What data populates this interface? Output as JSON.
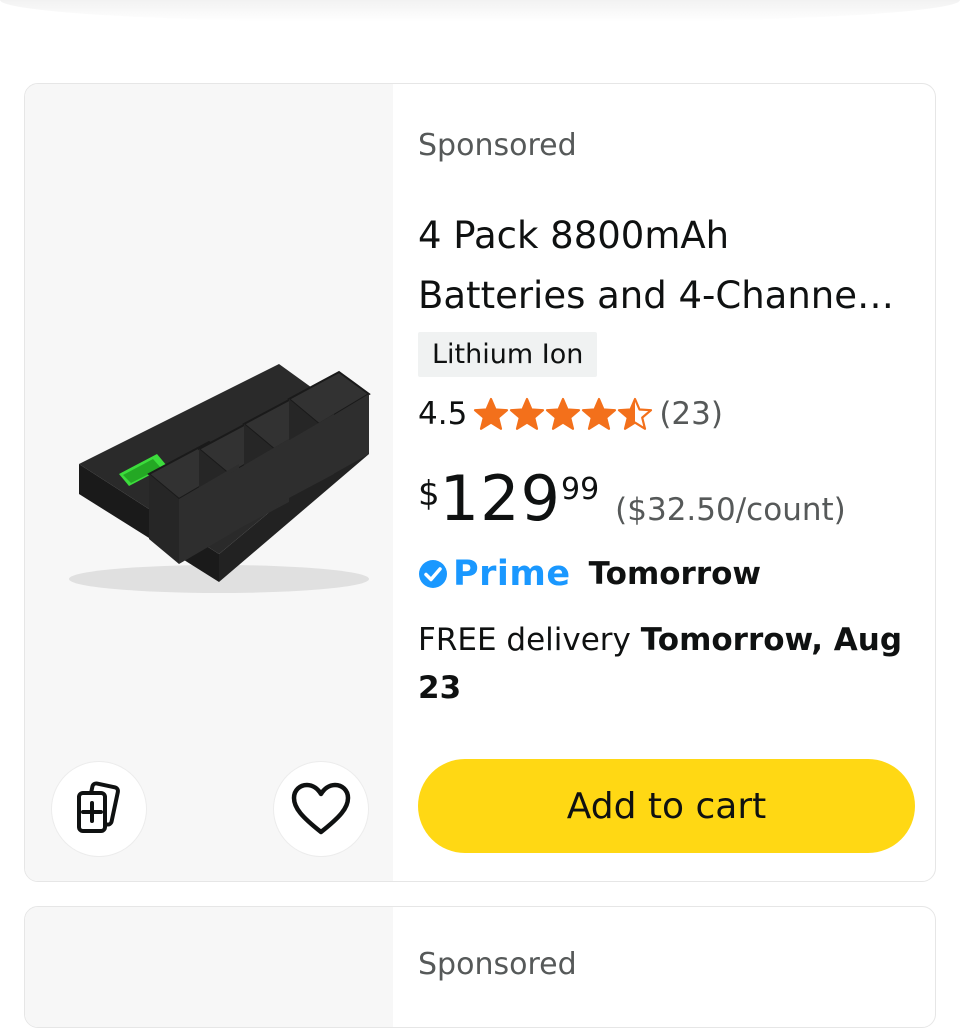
{
  "card": {
    "sponsored": "Sponsored",
    "title_line1": "4 Pack 8800mAh",
    "title_line2": "Batteries and 4-Channe…",
    "badge": "Lithium Ion",
    "rating": "4.5",
    "rating_value": 4.5,
    "stars_total": 5,
    "review_count": "(23)",
    "price_currency": "$",
    "price_whole": "129",
    "price_fraction": "99",
    "unit_price": "($32.50/count)",
    "prime_label": "Prime",
    "prime_delivery": "Tomorrow",
    "delivery_prefix": "FREE delivery ",
    "delivery_date": "Tomorrow, Aug 23",
    "add_to_cart": "Add to cart",
    "icons": {
      "compare": "compare-cards-icon",
      "wishlist": "heart-icon",
      "prime_check": "prime-check-icon",
      "star": "star-icon"
    }
  },
  "next_card": {
    "sponsored": "Sponsored"
  },
  "colors": {
    "star": "#f3701b",
    "prime_blue": "#1a98ff",
    "cart_button": "#ffd814",
    "image_bg": "#f7f7f7",
    "badge_bg": "#f0f2f2",
    "secondary_text": "#565959"
  }
}
